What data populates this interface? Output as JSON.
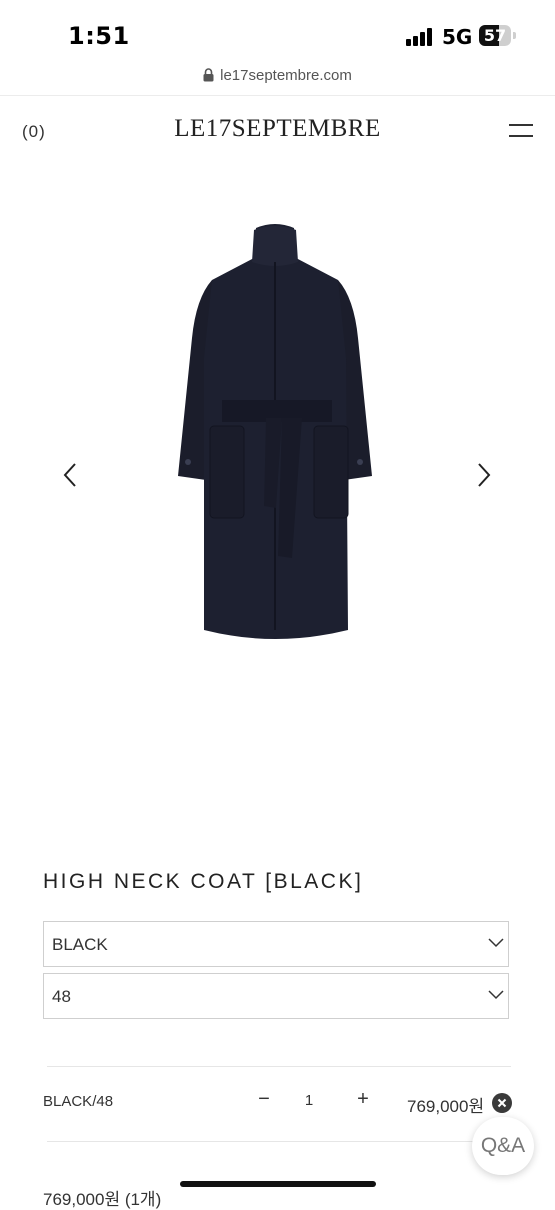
{
  "status_bar": {
    "time": "1:51",
    "network": "5G",
    "battery": "57"
  },
  "browser": {
    "url": "le17septembre.com"
  },
  "header": {
    "cart_count": "(0)",
    "logo": "LE17SEPTEMBRE",
    "menu_icon": "hamburger-menu-icon"
  },
  "gallery": {
    "prev_icon": "chevron-left-icon",
    "next_icon": "chevron-right-icon",
    "image": "black-high-neck-belted-coat"
  },
  "product": {
    "title": "HIGH NECK COAT [BLACK]",
    "color_select": "BLACK",
    "size_select": "48"
  },
  "selected_option": {
    "label": "BLACK/48",
    "minus": "−",
    "quantity": "1",
    "plus": "+",
    "price": "769,000원"
  },
  "floating": {
    "qa_label": "Q&A"
  },
  "total": {
    "text": "769,000원 (1개)"
  },
  "colors": {
    "coat": "#1b1d2b",
    "text": "#222222",
    "border": "#cfcfcf"
  }
}
